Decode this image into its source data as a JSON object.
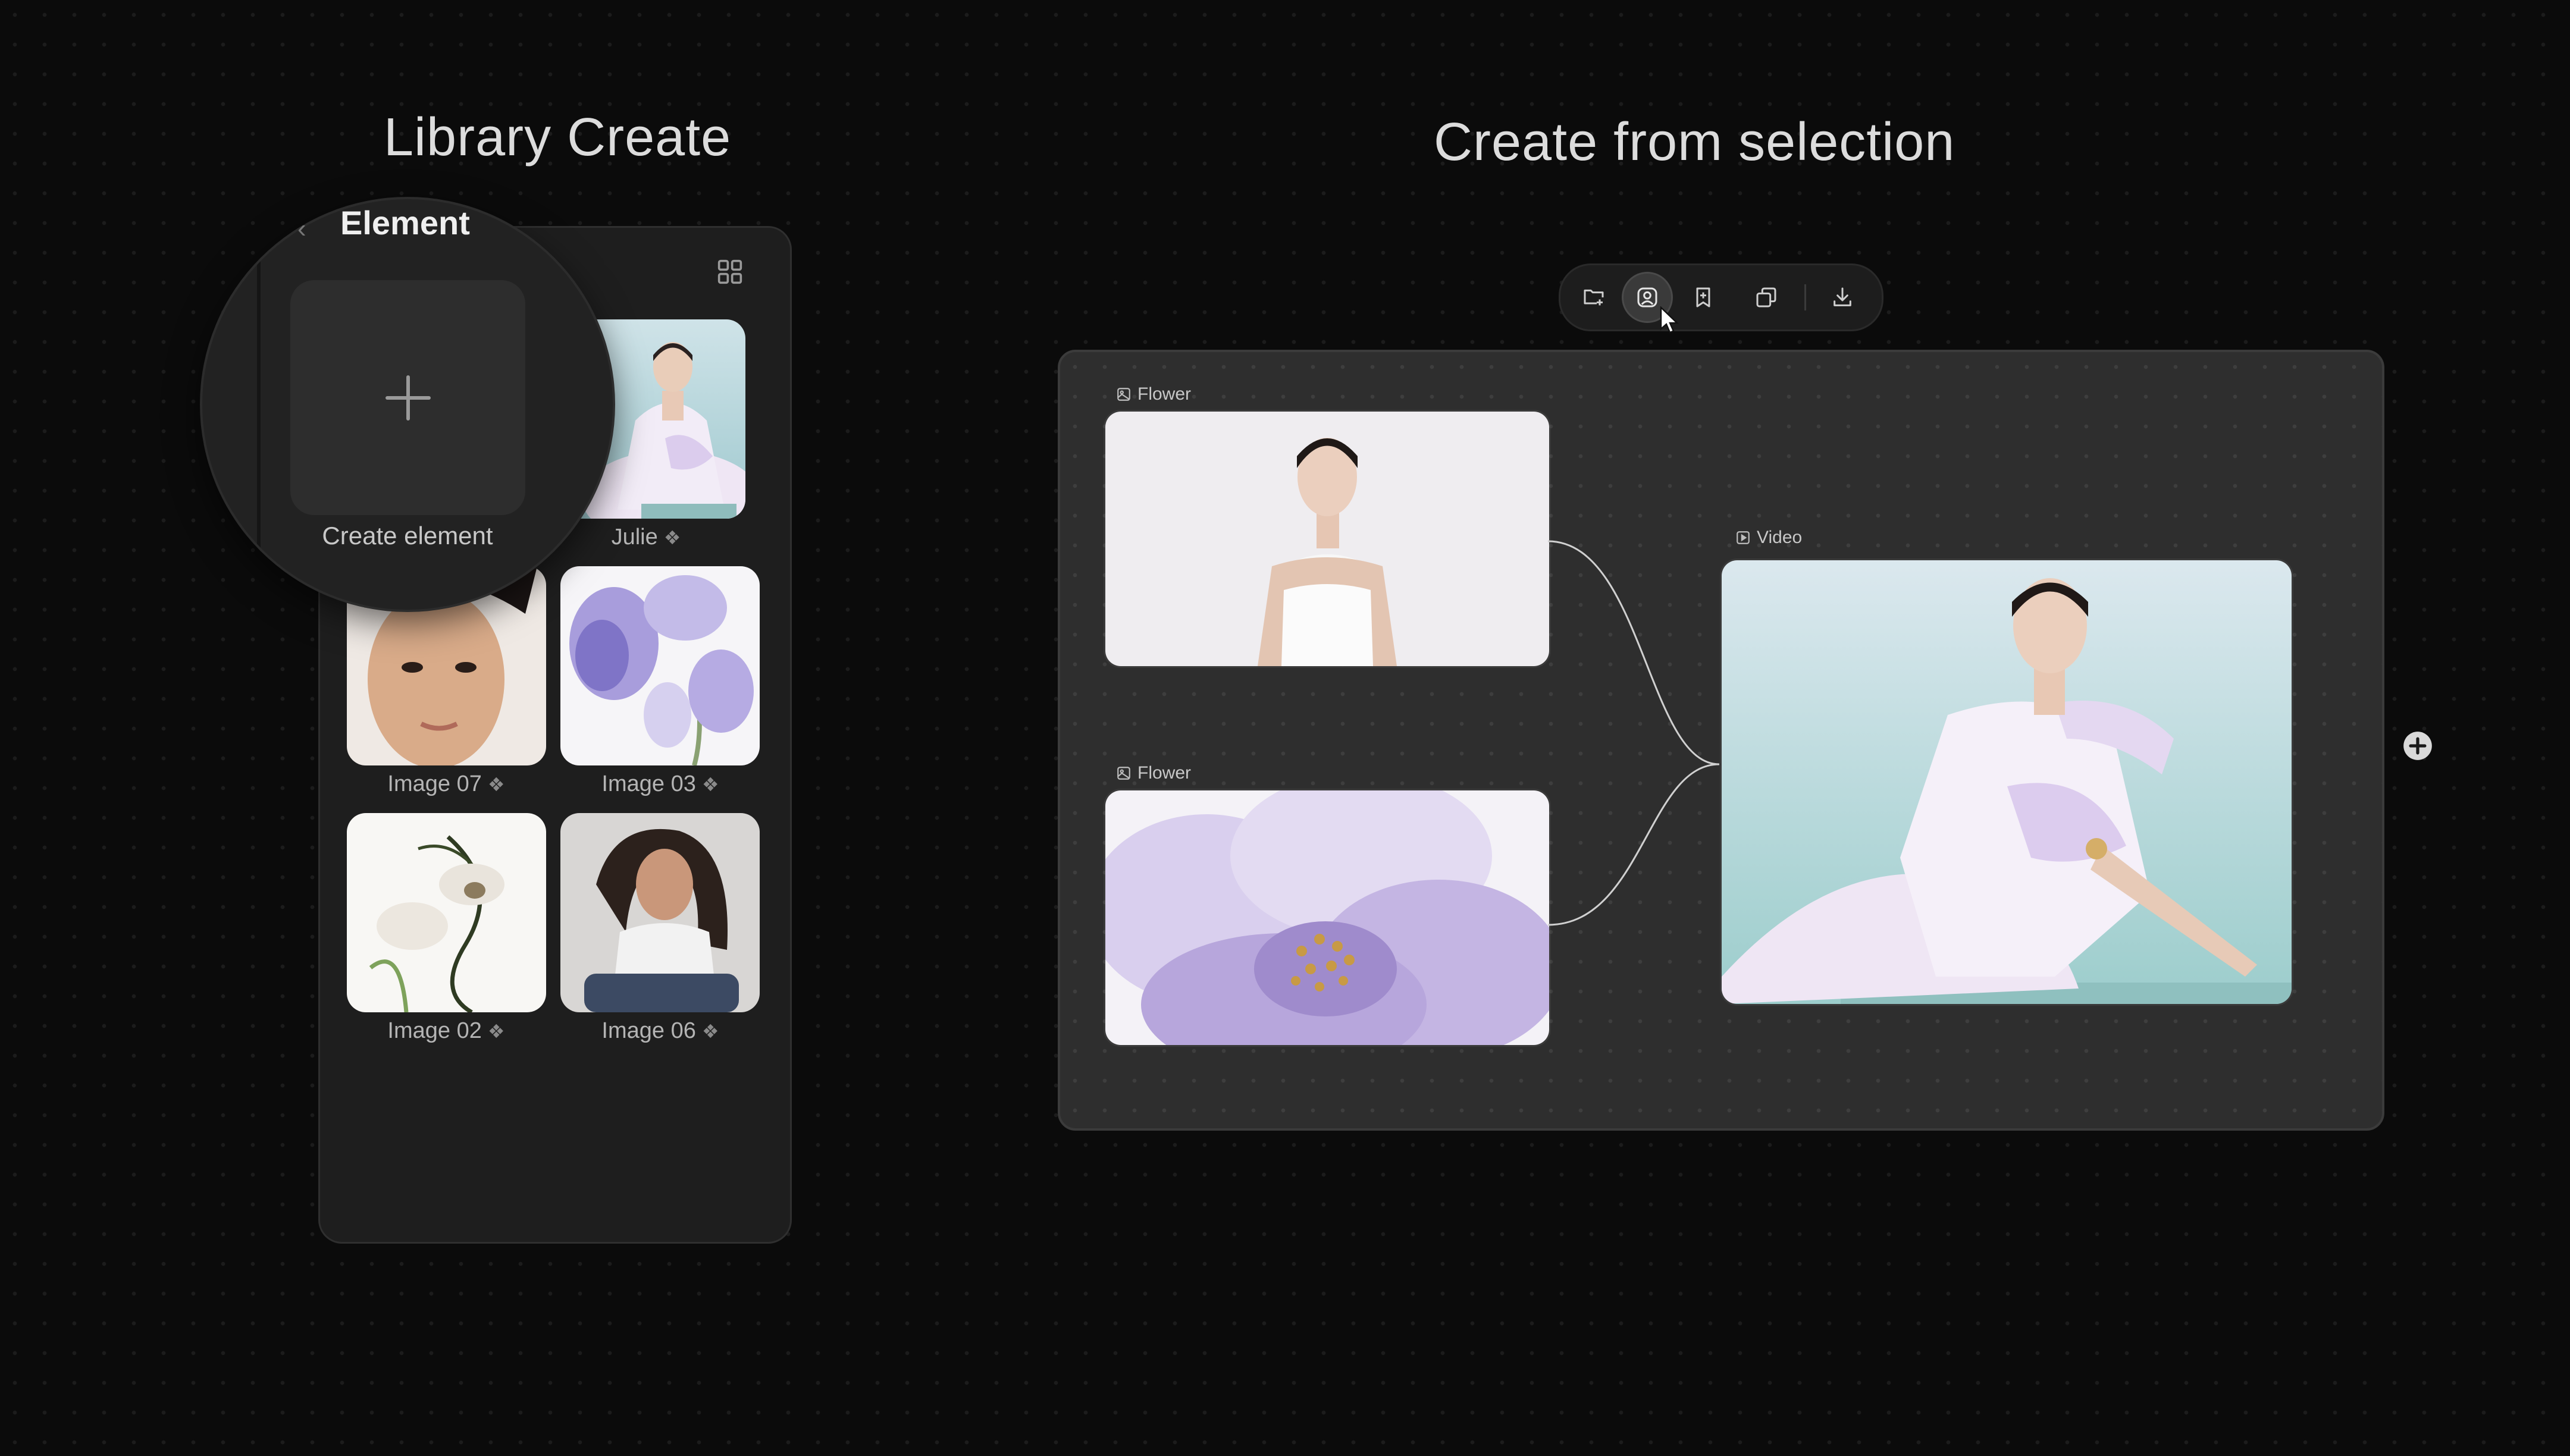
{
  "headings": {
    "library_create": "Library Create",
    "create_from_selection": "Create from selection"
  },
  "library": {
    "panel_title": "Element",
    "create_label": "Create element",
    "items": [
      {
        "label": "Julie",
        "badge_icon": "element-icon"
      },
      {
        "label": "Image 07",
        "badge_icon": "element-icon"
      },
      {
        "label": "Image 03",
        "badge_icon": "element-icon"
      },
      {
        "label": "Image 02",
        "badge_icon": "element-icon"
      },
      {
        "label": "Image 06",
        "badge_icon": "element-icon"
      }
    ],
    "badge_glyph": "❖",
    "view_toggle_icon": "grid-icon"
  },
  "toolbar": {
    "buttons": [
      {
        "icon": "folder-add-icon"
      },
      {
        "icon": "create-element-icon",
        "active": true
      },
      {
        "icon": "bookmark-icon"
      },
      {
        "icon": "duplicate-icon"
      },
      {
        "icon": "download-icon"
      }
    ]
  },
  "canvas": {
    "nodes": [
      {
        "type": "image",
        "label": "Flower"
      },
      {
        "type": "image",
        "label": "Flower"
      },
      {
        "type": "video",
        "label": "Video"
      }
    ]
  },
  "colors": {
    "background": "#0b0b0b",
    "panel": "#1e1e1e",
    "canvas": "#2e2e2e",
    "accent_lavender": "#b8a6e0",
    "text": "#dcdcdc"
  }
}
